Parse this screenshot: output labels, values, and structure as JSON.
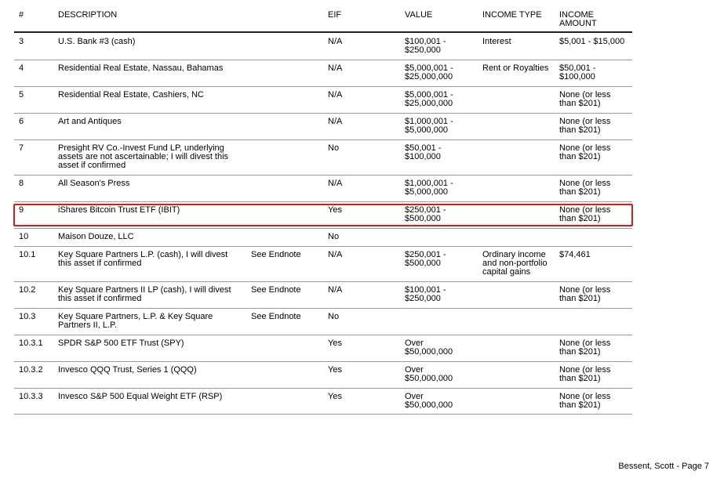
{
  "headers": {
    "num": "#",
    "description": "DESCRIPTION",
    "eif": "EIF",
    "value": "VALUE",
    "income_type": "INCOME TYPE",
    "income_amount": "INCOME\nAMOUNT"
  },
  "rows": [
    {
      "num": "3",
      "description": "U.S. Bank #3 (cash)",
      "note": "",
      "eif": "N/A",
      "value": "$100,001 -\n$250,000",
      "income_type": "Interest",
      "income_amount": "$5,001 - $15,000"
    },
    {
      "num": "4",
      "description": "Residential Real Estate, Nassau, Bahamas",
      "note": "",
      "eif": "N/A",
      "value": "$5,000,001 -\n$25,000,000",
      "income_type": "Rent or Royalties",
      "income_amount": "$50,001 -\n$100,000"
    },
    {
      "num": "5",
      "description": "Residential Real Estate, Cashiers, NC",
      "note": "",
      "eif": "N/A",
      "value": "$5,000,001 -\n$25,000,000",
      "income_type": "",
      "income_amount": "None (or less\nthan $201)"
    },
    {
      "num": "6",
      "description": "Art and Antiques",
      "note": "",
      "eif": "N/A",
      "value": "$1,000,001 -\n$5,000,000",
      "income_type": "",
      "income_amount": "None (or less\nthan $201)"
    },
    {
      "num": "7",
      "description": "Presight RV Co.-Invest Fund LP, underlying\nassets are not ascertainable; I will divest this\nasset if confirmed",
      "note": "",
      "eif": "No",
      "value": "$50,001 -\n$100,000",
      "income_type": "",
      "income_amount": "None (or less\nthan $201)"
    },
    {
      "num": "8",
      "description": "All Season's Press",
      "note": "",
      "eif": "N/A",
      "value": "$1,000,001 -\n$5,000,000",
      "income_type": "",
      "income_amount": "None (or less\nthan $201)"
    },
    {
      "num": "9",
      "description": "iShares Bitcoin Trust ETF (IBIT)",
      "note": "",
      "eif": "Yes",
      "value": "$250,001 -\n$500,000",
      "income_type": "",
      "income_amount": "None (or less\nthan $201)"
    },
    {
      "num": "10",
      "description": "Maison Douze, LLC",
      "note": "",
      "eif": "No",
      "value": "",
      "income_type": "",
      "income_amount": ""
    },
    {
      "num": "10.1",
      "description": "Key Square Partners L.P. (cash), I will divest\nthis asset if confirmed",
      "note": "See Endnote",
      "eif": "N/A",
      "value": "$250,001 -\n$500,000",
      "income_type": "Ordinary income\nand non-portfolio\ncapital gains",
      "income_amount": "$74,461"
    },
    {
      "num": "10.2",
      "description": "Key Square Partners II LP (cash), I will divest\nthis asset if confirmed",
      "note": "See Endnote",
      "eif": "N/A",
      "value": "$100,001 -\n$250,000",
      "income_type": "",
      "income_amount": "None (or less\nthan $201)"
    },
    {
      "num": "10.3",
      "description": "Key Square Partners, L.P. & Key Square\nPartners II, L.P.",
      "note": "See Endnote",
      "eif": "No",
      "value": "",
      "income_type": "",
      "income_amount": ""
    },
    {
      "num": "10.3.1",
      "description": "SPDR S&P 500 ETF Trust (SPY)",
      "note": "",
      "eif": "Yes",
      "value": "Over\n$50,000,000",
      "income_type": "",
      "income_amount": "None (or less\nthan $201)"
    },
    {
      "num": "10.3.2",
      "description": "Invesco QQQ Trust, Series 1 (QQQ)",
      "note": "",
      "eif": "Yes",
      "value": "Over\n$50,000,000",
      "income_type": "",
      "income_amount": "None (or less\nthan $201)"
    },
    {
      "num": "10.3.3",
      "description": "Invesco S&P 500 Equal Weight ETF (RSP)",
      "note": "",
      "eif": "Yes",
      "value": "Over\n$50,000,000",
      "income_type": "",
      "income_amount": "None (or less\nthan $201)"
    }
  ],
  "footer": "Bessent, Scott - Page 7"
}
